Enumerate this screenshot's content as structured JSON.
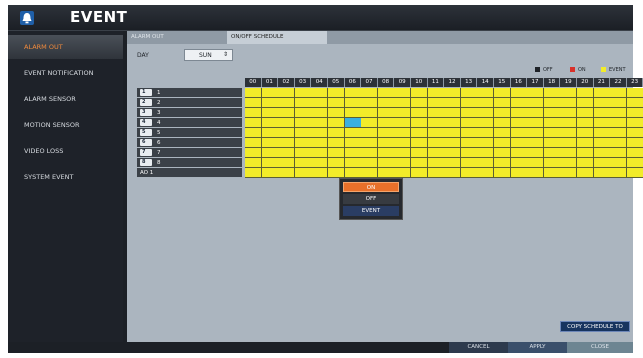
{
  "window": {
    "title": "EVENT"
  },
  "sidebar": {
    "items": [
      {
        "label": "ALARM OUT",
        "active": true
      },
      {
        "label": "EVENT NOTIFICATION",
        "active": false
      },
      {
        "label": "ALARM SENSOR",
        "active": false
      },
      {
        "label": "MOTION SENSOR",
        "active": false
      },
      {
        "label": "VIDEO LOSS",
        "active": false
      },
      {
        "label": "SYSTEM EVENT",
        "active": false
      }
    ]
  },
  "tabs": [
    {
      "label": "ALARM OUT",
      "active": false
    },
    {
      "label": "ON/OFF SCHEDULE",
      "active": true
    }
  ],
  "day": {
    "label": "DAY",
    "value": "SUN"
  },
  "legend": [
    {
      "label": "OFF",
      "color": "#1f2328"
    },
    {
      "label": "ON",
      "color": "#d9312a"
    },
    {
      "label": "EVENT",
      "color": "#f2ec29"
    }
  ],
  "schedule": {
    "hours": [
      "00",
      "01",
      "02",
      "03",
      "04",
      "05",
      "06",
      "07",
      "08",
      "09",
      "10",
      "11",
      "12",
      "13",
      "14",
      "15",
      "16",
      "17",
      "18",
      "19",
      "20",
      "21",
      "22",
      "23"
    ],
    "rows": [
      {
        "badge": "1",
        "label": "1"
      },
      {
        "badge": "2",
        "label": "2"
      },
      {
        "badge": "3",
        "label": "3"
      },
      {
        "badge": "4",
        "label": "4"
      },
      {
        "badge": "5",
        "label": "5"
      },
      {
        "badge": "6",
        "label": "6"
      },
      {
        "badge": "7",
        "label": "7"
      },
      {
        "badge": "8",
        "label": "8"
      },
      {
        "badge": "",
        "label": "AO 1"
      }
    ],
    "highlight": {
      "row": 3,
      "hour": 6,
      "state": "event"
    },
    "colors": {
      "event": "#f2ec29",
      "selected": "#3ab0e0"
    }
  },
  "popup_menu": {
    "items": [
      "ON",
      "OFF",
      "EVENT"
    ]
  },
  "buttons": {
    "copy": "COPY SCHEDULE TO",
    "cancel": "CANCEL",
    "apply": "APPLY",
    "close": "CLOSE"
  }
}
